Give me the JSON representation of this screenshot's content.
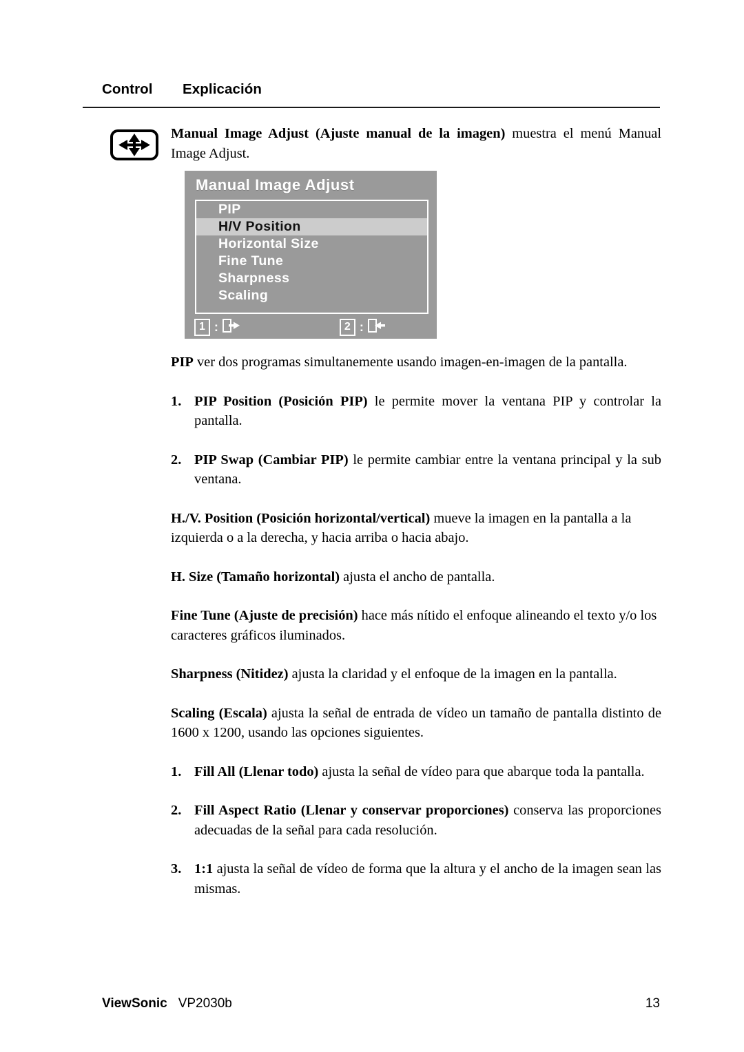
{
  "header": {
    "col_control": "Control",
    "col_explicacion": "Explicación"
  },
  "control_icon": {
    "name": "four-way-navigation-icon"
  },
  "intro": {
    "bold_lead": "Manual Image Adjust (Ajuste manual de la imagen)",
    "rest": "  muestra el menú Manual Image Adjust."
  },
  "osd": {
    "title": "Manual Image Adjust",
    "items": [
      {
        "label": "PIP",
        "selected": false
      },
      {
        "label": "H/V Position",
        "selected": true
      },
      {
        "label": "Horizontal Size",
        "selected": false
      },
      {
        "label": "Fine Tune",
        "selected": false
      },
      {
        "label": "Sharpness",
        "selected": false
      },
      {
        "label": "Scaling",
        "selected": false
      }
    ],
    "footer_keys": [
      {
        "key": "1",
        "colon": ":",
        "glyph": "exit-right-arrow-icon"
      },
      {
        "key": "2",
        "colon": ":",
        "glyph": "exit-left-arrow-icon"
      }
    ],
    "colors": {
      "background": "#9a9a9a",
      "selected_row": "#cccccc",
      "text": "#ffffff",
      "selected_text": "#111111"
    }
  },
  "sections": [
    {
      "id": "pip",
      "bold": "PIP",
      "text": " ver dos programas simultanemente usando imagen-en-imagen de la pantalla."
    },
    {
      "id": "pip-position",
      "number": "1.",
      "bold": "PIP Position (Posición PIP)",
      "text": " le permite mover la ventana PIP y controlar la pantalla."
    },
    {
      "id": "pip-swap",
      "number": "2.",
      "bold": "PIP Swap (Cambiar PIP)",
      "text": " le permite cambiar entre la ventana principal y la sub ventana."
    },
    {
      "id": "hv-position",
      "bold": "H./V. Position (Posición horizontal/vertical)",
      "text": " mueve la imagen en la pantalla a la izquierda o a la derecha, y hacia arriba o hacia abajo."
    },
    {
      "id": "h-size",
      "bold": "H. Size (Tamaño horizontal)",
      "text": " ajusta el ancho de pantalla."
    },
    {
      "id": "fine-tune",
      "bold": "Fine Tune (Ajuste de precisión)",
      "text": " hace más nítido el enfoque alineando el texto y/o los caracteres gráficos iluminados."
    },
    {
      "id": "sharpness",
      "bold": "Sharpness (Nitidez)",
      "text": " ajusta la claridad y el enfoque de la imagen en la pantalla."
    },
    {
      "id": "scaling",
      "bold": "Scaling (Escala)",
      "text": " ajusta la señal de entrada de vídeo un tamaño de pantalla distinto de 1600 x 1200, usando las opciones siguientes."
    },
    {
      "id": "fill-all",
      "number": "1.",
      "bold": "Fill All (Llenar todo)",
      "text": " ajusta la señal de vídeo para que abarque toda la pantalla."
    },
    {
      "id": "fill-aspect-ratio",
      "number": "2.",
      "bold": "Fill Aspect Ratio (Llenar y conservar proporciones)",
      "text": " conserva las proporciones adecuadas de la señal para cada resolución."
    },
    {
      "id": "one-to-one",
      "number": "3.",
      "bold": "1:1",
      "text": " ajusta la señal de vídeo de forma que la altura y el ancho de la imagen sean las mismas."
    }
  ],
  "footer": {
    "brand": "ViewSonic",
    "model": "VP2030b",
    "page": "13"
  }
}
